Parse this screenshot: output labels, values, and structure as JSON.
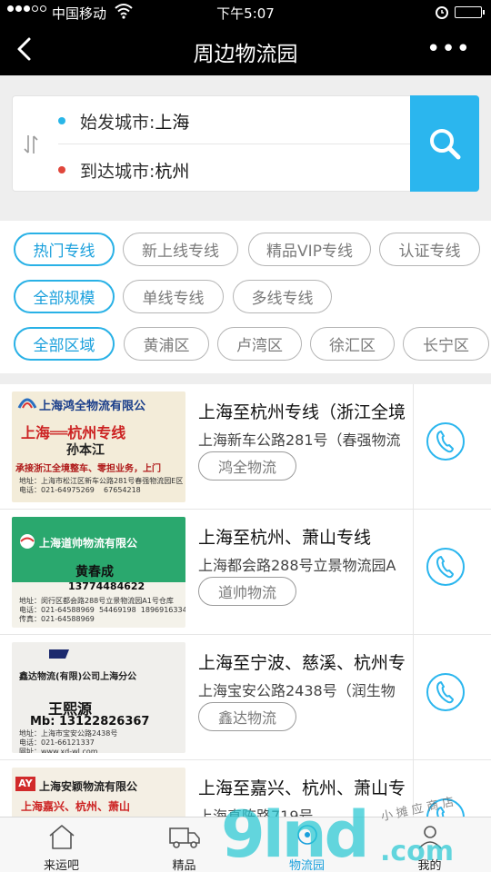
{
  "status_bar": {
    "carrier": "中国移动",
    "time": "下午5:07"
  },
  "nav": {
    "title": "周边物流园",
    "more": "•••"
  },
  "search": {
    "origin_label": "始发城市:",
    "origin_value": "上海",
    "dest_label": "到达城市:",
    "dest_value": "杭州",
    "origin_dot_color": "#29b6e8",
    "dest_dot_color": "#e0463b"
  },
  "filters": {
    "row1": [
      "热门专线",
      "新上线专线",
      "精品VIP专线",
      "认证专线"
    ],
    "row2": [
      "全部规模",
      "单线专线",
      "多线专线"
    ],
    "row3": [
      "全部区域",
      "黄浦区",
      "卢湾区",
      "徐汇区",
      "长宁区"
    ]
  },
  "listings": [
    {
      "title": "上海至杭州专线（浙江全境",
      "address": "上海新车公路281号（春强物流",
      "tag": "鸿全物流",
      "card": {
        "company": "上海鸿全物流有限公",
        "route": "上海══杭州专线",
        "person": "孙本江",
        "note": "承接浙江全境整车、零担业务，上门",
        "small": "地址：上海市松江区新车公路281号春强物流园E区\n电话：021-64975269    67654218"
      }
    },
    {
      "title": "上海至杭州、萧山专线",
      "address": "上海都会路288号立景物流园A",
      "tag": "道帅物流",
      "card": {
        "company": "上海道帅物流有限公",
        "person": "黄春成",
        "phone": "13774484622",
        "small": "地址：闵行区都会路288号立景物流园A1号仓库\n电话：021-64588969  54469198  18969163340\n传真：021-64588969"
      }
    },
    {
      "title": "上海至宁波、慈溪、杭州专",
      "address": "上海宝安公路2438号（润生物",
      "tag": "鑫达物流",
      "card": {
        "company": "鑫达物流(有限)公司上海分公",
        "person": "王熙源",
        "phone": "Mb: 13122826367",
        "small": "地址：上海市宝安公路2438号\n电话：021-66121337\n网址：www.xd-wl.com"
      }
    },
    {
      "title": "上海至嘉兴、杭州、萧山专",
      "address": "上海真陈路719号",
      "tag": "",
      "card": {
        "company": "上海安颖物流有限公",
        "route": "上海嘉兴、杭州、萧山"
      }
    }
  ],
  "tabs": [
    "来运吧",
    "精品",
    "物流园",
    "我的"
  ],
  "colors": {
    "accent": "#2bb6ee",
    "active_text": "#1aa0dc",
    "header_bg": "#000000"
  }
}
